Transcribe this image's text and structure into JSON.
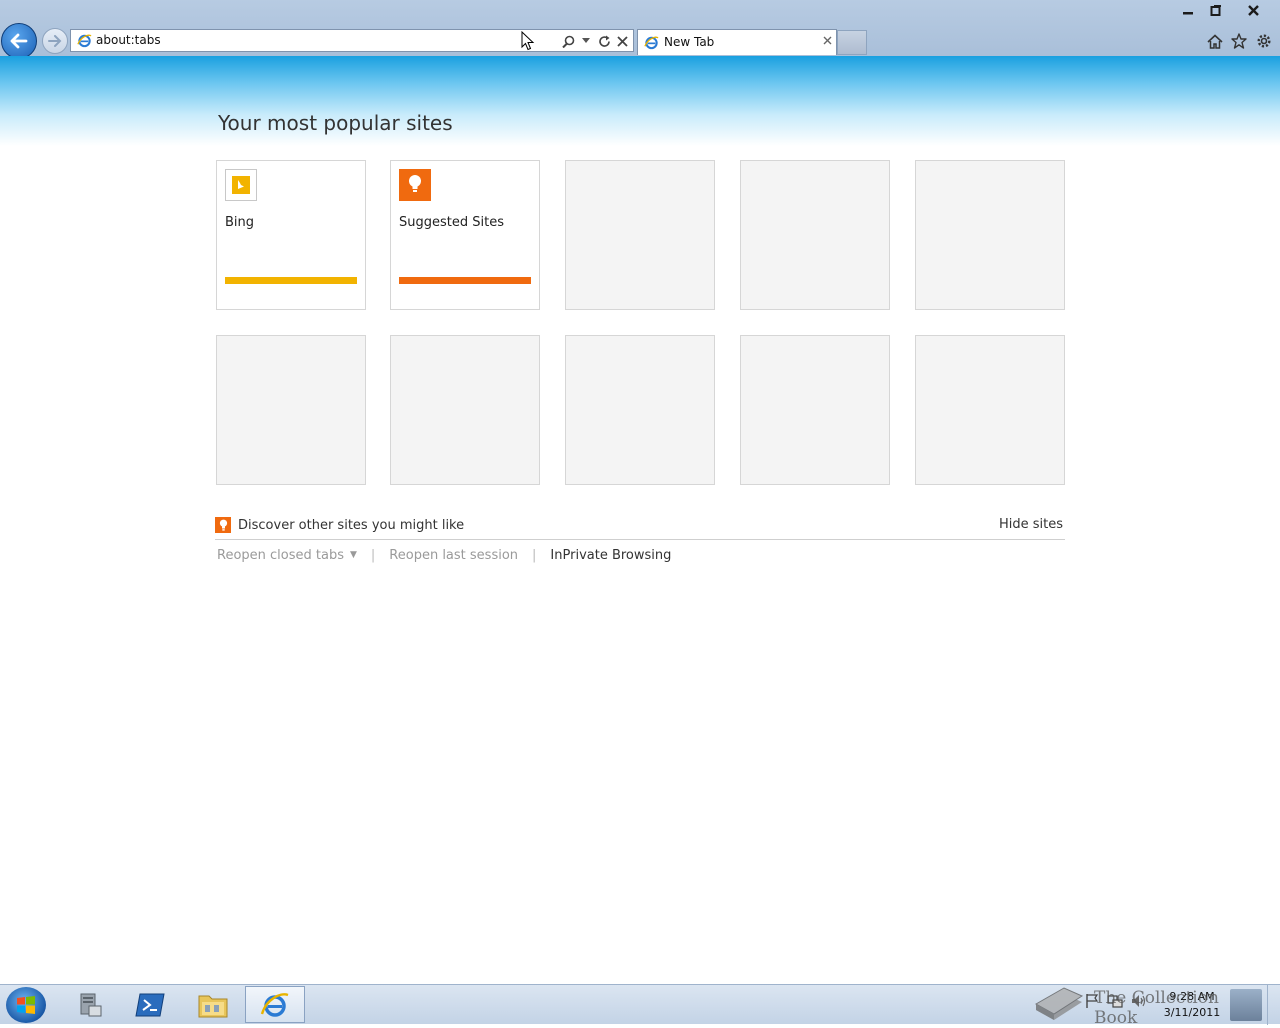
{
  "browser": {
    "address": "about:tabs",
    "tab_title": "New Tab"
  },
  "page": {
    "title": "Your most popular sites",
    "tiles": [
      {
        "name": "Bing",
        "bar_color": "#f2b300",
        "icon": "bing-icon"
      },
      {
        "name": "Suggested Sites",
        "bar_color": "#f06a0f",
        "icon": "lightbulb-icon"
      }
    ],
    "discover_text": "Discover other sites you might like",
    "hide_sites": "Hide sites",
    "reopen_closed_tabs": "Reopen closed tabs",
    "reopen_last_session": "Reopen last session",
    "inprivate": "InPrivate Browsing",
    "separator": "|"
  },
  "taskbar": {
    "time": "9:28 AM",
    "date": "3/11/2011",
    "watermark": "The Collection Book"
  },
  "colors": {
    "accent_blue": "#1aa0e0",
    "bing_yellow": "#f2b300",
    "suggested_orange": "#f06a0f"
  }
}
